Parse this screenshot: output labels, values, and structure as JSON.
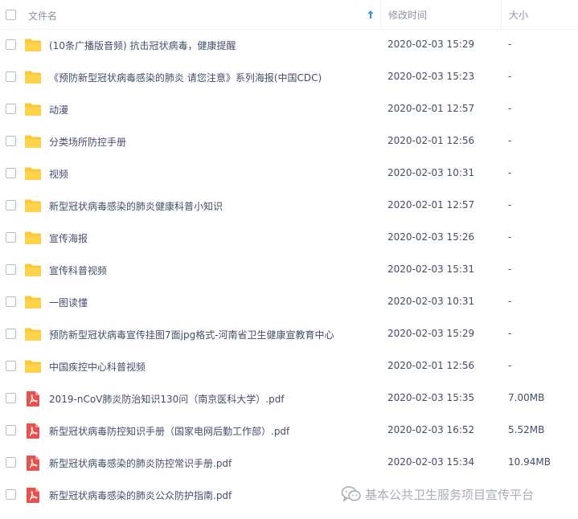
{
  "header": {
    "name_label": "文件名",
    "time_label": "修改时间",
    "size_label": "大小",
    "sort_icon": "sort-ascending-arrow-icon"
  },
  "files": [
    {
      "type": "folder",
      "name": "(10条广播版音频) 抗击冠状病毒，健康提醒",
      "time": "2020-02-03 15:29",
      "size": "-"
    },
    {
      "type": "folder",
      "name": "《预防新型冠状病毒感染的肺炎 请您注意》系列海报(中国CDC)",
      "time": "2020-02-03 15:23",
      "size": "-"
    },
    {
      "type": "folder",
      "name": "动漫",
      "time": "2020-02-01 12:57",
      "size": "-"
    },
    {
      "type": "folder",
      "name": "分类场所防控手册",
      "time": "2020-02-01 12:56",
      "size": "-"
    },
    {
      "type": "folder",
      "name": "视频",
      "time": "2020-02-03 10:31",
      "size": "-"
    },
    {
      "type": "folder",
      "name": "新型冠状病毒感染的肺炎健康科普小知识",
      "time": "2020-02-01 12:57",
      "size": "-"
    },
    {
      "type": "folder",
      "name": "宣传海报",
      "time": "2020-02-03 15:26",
      "size": "-"
    },
    {
      "type": "folder",
      "name": "宣传科普视频",
      "time": "2020-02-03 15:31",
      "size": "-"
    },
    {
      "type": "folder",
      "name": "一图读懂",
      "time": "2020-02-03 10:31",
      "size": "-"
    },
    {
      "type": "folder",
      "name": "预防新型冠状病毒宣传挂图7面jpg格式-河南省卫生健康宣教育中心",
      "time": "2020-02-03 15:29",
      "size": "-"
    },
    {
      "type": "folder",
      "name": "中国疾控中心科普视频",
      "time": "2020-02-01 12:56",
      "size": "-"
    },
    {
      "type": "pdf",
      "name": "2019-nCoV肺炎防治知识130问（南京医科大学）.pdf",
      "time": "2020-02-03 15:35",
      "size": "7.00MB"
    },
    {
      "type": "pdf",
      "name": "新型冠状病毒防控知识手册（国家电网后勤工作部）.pdf",
      "time": "2020-02-03 16:52",
      "size": "5.52MB"
    },
    {
      "type": "pdf",
      "name": "新型冠状病毒感染的肺炎防控常识手册.pdf",
      "time": "2020-02-03 15:34",
      "size": "10.94MB"
    },
    {
      "type": "pdf",
      "name": "新型冠状病毒感染的肺炎公众防护指南.pdf",
      "time": "",
      "size": ""
    }
  ],
  "watermark": {
    "text": "基本公共卫生服务项目宣传平台",
    "icon": "wechat-icon"
  },
  "colors": {
    "folder": "#f9c835",
    "pdf": "#e9514f",
    "accent": "#2f8ef3",
    "text": "#424e67",
    "header_text": "#8a93a3"
  }
}
